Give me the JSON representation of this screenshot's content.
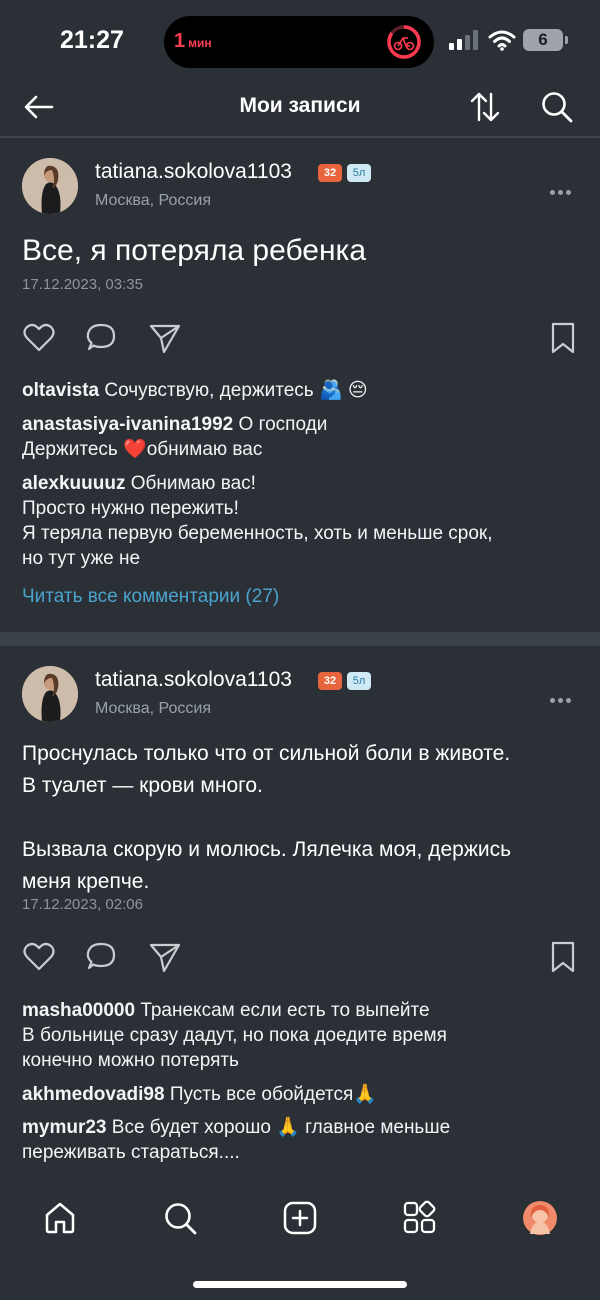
{
  "status_bar": {
    "time": "21:27",
    "live_timer": "1",
    "live_timer_unit": "мин",
    "battery": "6"
  },
  "header": {
    "title": "Мои записи",
    "icons": [
      "back-arrow-icon",
      "sort-icon",
      "search-icon"
    ]
  },
  "posts": [
    {
      "username": "tatiana.sokolova1103",
      "age_badge": "32",
      "time_badge": "5л",
      "location": "Москва, Россия",
      "text_lines": [
        "Все, я потеряла ребенка"
      ],
      "date": "17.12.2023, 03:35",
      "comments": [
        {
          "user": "oltavista",
          "lines": [
            "Сочувствую, держитесь 🫂 😔"
          ]
        },
        {
          "user": "anastasiya-ivanina1992",
          "lines": [
            "О господи",
            "Держитесь ❤️обнимаю вас"
          ]
        },
        {
          "user": "alexkuuuuz",
          "lines": [
            "Обнимаю вас!",
            "Просто нужно пережить!",
            "Я теряла первую беременность, хоть и меньше срок,",
            "но тут уже не"
          ]
        }
      ],
      "read_all": "Читать все комментарии (27)"
    },
    {
      "username": "tatiana.sokolova1103",
      "age_badge": "32",
      "time_badge": "5л",
      "location": "Москва, Россия",
      "text_lines": [
        "Проснулась только что от сильной боли в животе.",
        "В туалет — крови много.",
        "",
        "Вызвала скорую и молюсь. Лялечка моя, держись",
        "меня крепче."
      ],
      "date": "17.12.2023, 02:06",
      "comments": [
        {
          "user": "masha00000",
          "lines": [
            "Транексам если есть то выпейте",
            "В больнице сразу дадут, но пока доедите время",
            "конечно можно потерять"
          ]
        },
        {
          "user": "akhmedovadi98",
          "lines": [
            "Пусть все обойдется🙏"
          ]
        },
        {
          "user": "mymur23",
          "lines": [
            "Все будет хорошо 🙏 главное меньше",
            "переживать стараться...."
          ]
        }
      ]
    }
  ],
  "bottom_nav": [
    "home-icon",
    "search-icon",
    "add-post-icon",
    "services-icon",
    "profile-icon"
  ],
  "colors": {
    "background": "#2b3036",
    "link": "#4ba3cf",
    "age_badge": "#e8643c",
    "time_badge": "#cfeaf4",
    "live_timer": "#ff3b52"
  }
}
